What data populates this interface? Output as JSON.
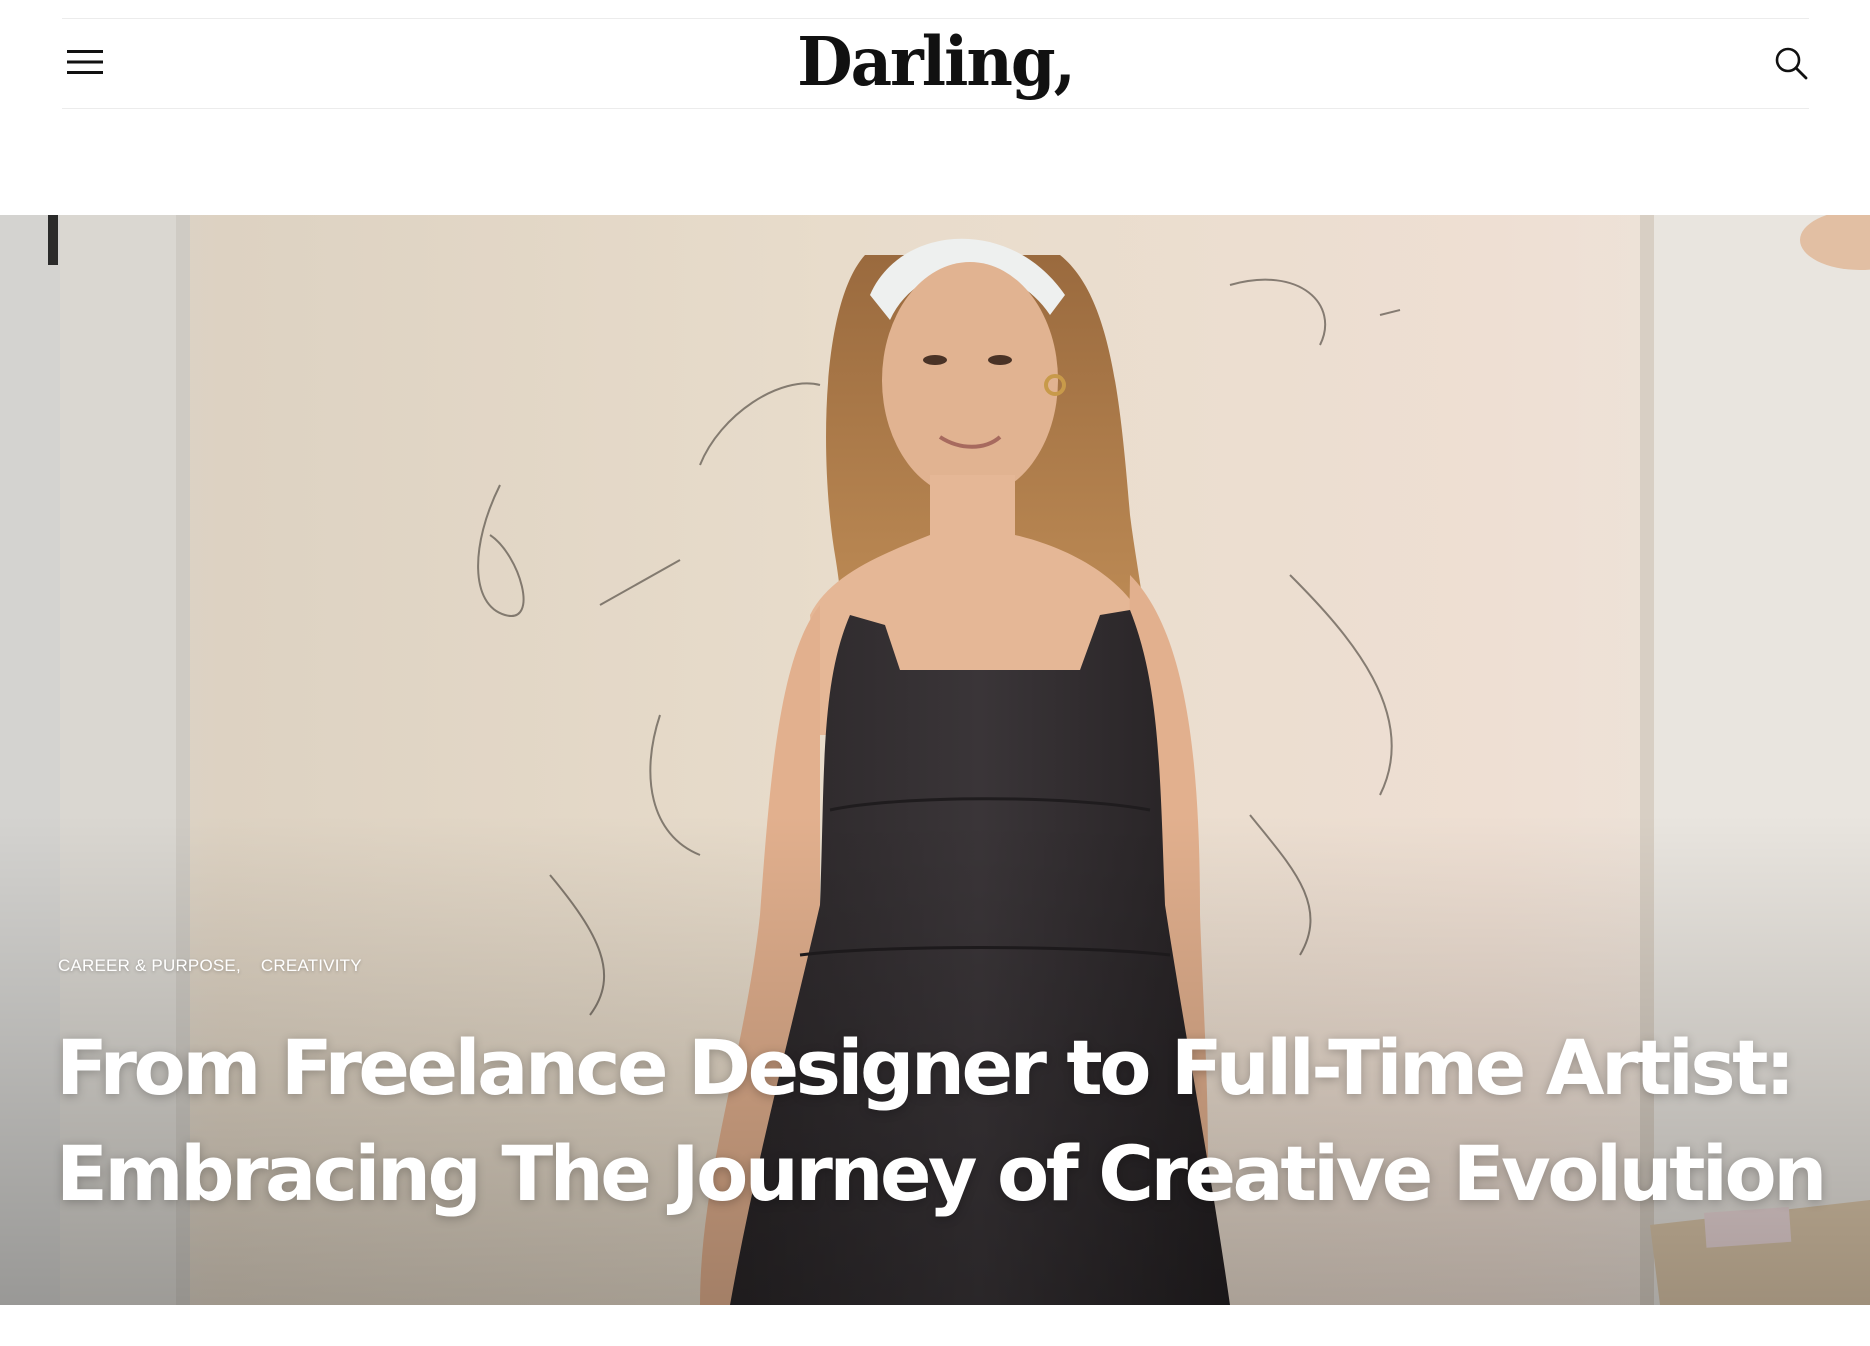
{
  "header": {
    "logo_text": "Darling,",
    "menu_icon": "hamburger-menu-icon",
    "search_icon": "search-icon"
  },
  "hero": {
    "categories": [
      "CAREER & PURPOSE,",
      "CREATIVITY"
    ],
    "title_line_1": "From Freelance Designer to Full-Time Artist:",
    "title_line_2": "Embracing The Journey of Creative Evolution"
  },
  "colors": {
    "text": "#111111",
    "overlay_text": "#ffffff",
    "rule": "#ececec"
  }
}
